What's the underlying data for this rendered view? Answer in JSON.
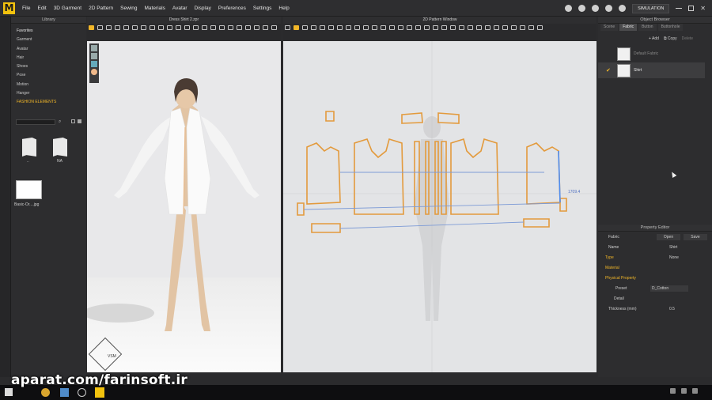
{
  "app": {
    "logo_letter": "M",
    "accent": "#f2c20e"
  },
  "menu": [
    "File",
    "Edit",
    "3D Garment",
    "2D Pattern",
    "Sewing",
    "Materials",
    "Avatar",
    "Display",
    "Preferences",
    "Settings",
    "Help"
  ],
  "topbar": {
    "simulation_label": "SIMULATION"
  },
  "library": {
    "title": "Library",
    "items": [
      "Favorites",
      "Garment",
      "Avatar",
      "Hair",
      "Shoes",
      "Pose",
      "Motion",
      "Hanger"
    ],
    "highlight": "FASHION ELEMENTS",
    "thumbs": [
      {
        "label": ".."
      },
      {
        "label": "NA"
      }
    ],
    "file_label": "Basic-Or....jpg"
  },
  "window3d": {
    "title": "Dress Shirt 2.zpr",
    "vsm_label": "VSM"
  },
  "window2d": {
    "title": "2D Pattern Window",
    "measure_label": "1709.4"
  },
  "object_browser": {
    "title": "Object Browser",
    "tabs": [
      "Scene",
      "Fabric",
      "Button",
      "Buttonhole"
    ],
    "active_tab": "Fabric",
    "add_label": "Add",
    "copy_label": "Copy",
    "delete_label": "Delete",
    "fabrics": [
      {
        "name": "Default Fabric",
        "checked": false
      },
      {
        "name": "Shirt",
        "checked": true
      }
    ]
  },
  "property_editor": {
    "title": "Property Editor",
    "fabric_label": "Fabric",
    "open_label": "Open",
    "save_label": "Save",
    "name_label": "Name",
    "name_value": "Shirt",
    "type_label": "Type",
    "type_value": "None",
    "material_label": "Material",
    "physical_label": "Physical Property",
    "preset_label": "Preset",
    "preset_value": "D_Cotton",
    "detail_label": "Detail",
    "thickness_label": "Thickness (mm)",
    "thickness_value": "0.5"
  },
  "watermark": "aparat.com/farinsoft.ir"
}
